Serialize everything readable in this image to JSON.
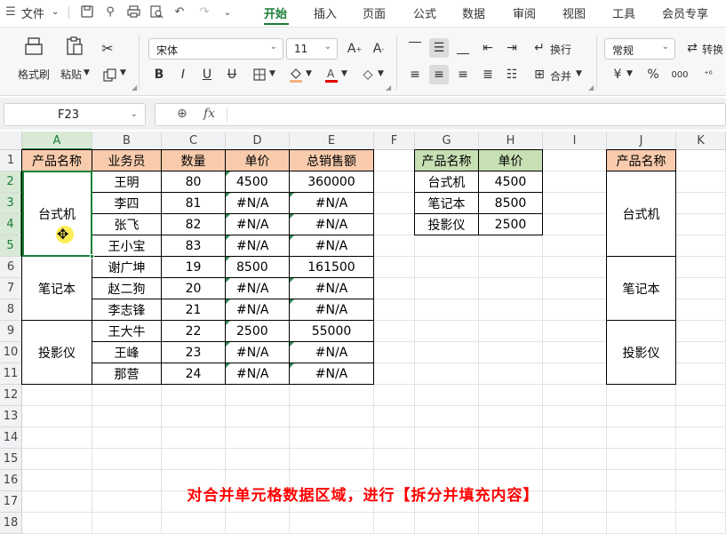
{
  "menubar": {
    "file_label": "文件",
    "tabs": [
      "开始",
      "插入",
      "页面",
      "公式",
      "数据",
      "审阅",
      "视图",
      "工具",
      "会员专享"
    ],
    "active_tab": "开始"
  },
  "ribbon": {
    "format_painter": "格式刷",
    "paste": "粘贴",
    "font_name": "宋体",
    "font_size": "11",
    "wrap": "换行",
    "merge": "合并",
    "number_format": "常规",
    "convert": "转换",
    "percent": "%",
    "bold": "B",
    "italic": "I",
    "underline": "U",
    "currency": "¥"
  },
  "formula_bar": {
    "name_box": "F23",
    "fx": "fx",
    "content": ""
  },
  "columns": [
    "A",
    "B",
    "C",
    "D",
    "E",
    "F",
    "G",
    "H",
    "I",
    "J",
    "K"
  ],
  "selected_column": "A",
  "rows": [
    "1",
    "2",
    "3",
    "4",
    "5",
    "6",
    "7",
    "8",
    "9",
    "10",
    "11",
    "12",
    "13",
    "14",
    "15",
    "16",
    "17",
    "18"
  ],
  "selected_rows": [
    "2",
    "3",
    "4",
    "5"
  ],
  "table1": {
    "headers": [
      "产品名称",
      "业务员",
      "数量",
      "单价",
      "总销售额"
    ],
    "merged_products": [
      "台式机",
      "笔记本",
      "投影仪"
    ],
    "rows": [
      [
        "王明",
        "80",
        "4500",
        "360000"
      ],
      [
        "李四",
        "81",
        "#N/A",
        "#N/A"
      ],
      [
        "张飞",
        "82",
        "#N/A",
        "#N/A"
      ],
      [
        "王小宝",
        "83",
        "#N/A",
        "#N/A"
      ],
      [
        "谢广坤",
        "19",
        "8500",
        "161500"
      ],
      [
        "赵二狗",
        "20",
        "#N/A",
        "#N/A"
      ],
      [
        "李志锋",
        "21",
        "#N/A",
        "#N/A"
      ],
      [
        "王大牛",
        "22",
        "2500",
        "55000"
      ],
      [
        "王峰",
        "23",
        "#N/A",
        "#N/A"
      ],
      [
        "那营",
        "24",
        "#N/A",
        "#N/A"
      ]
    ]
  },
  "table2": {
    "headers": [
      "产品名称",
      "单价"
    ],
    "rows": [
      [
        "台式机",
        "4500"
      ],
      [
        "笔记本",
        "8500"
      ],
      [
        "投影仪",
        "2500"
      ]
    ]
  },
  "table3": {
    "header": "产品名称",
    "products": [
      "台式机",
      "笔记本",
      "投影仪"
    ]
  },
  "caption": "对合并单元格数据区域，进行【拆分并填充内容】",
  "colors": {
    "accent": "#1a7f37",
    "header_orange": "#f8cbad",
    "header_green": "#c6e0b4",
    "caption": "#ff0000"
  }
}
